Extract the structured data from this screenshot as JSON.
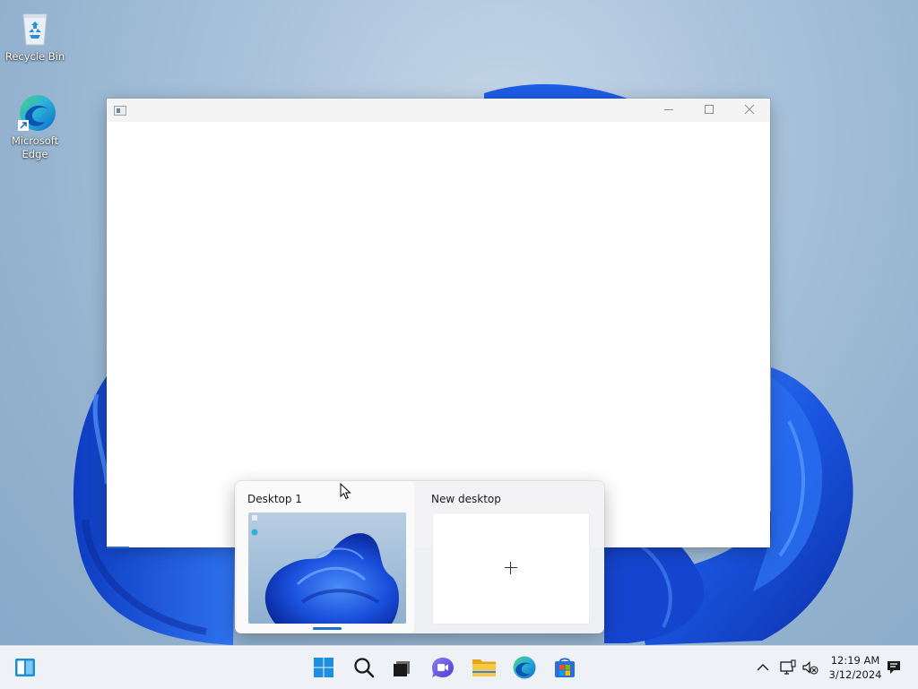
{
  "desktop_icons": [
    {
      "label": "Recycle Bin",
      "icon": "recycle-bin-icon"
    },
    {
      "label_line1": "Microsoft",
      "label_line2": "Edge",
      "icon": "edge-icon"
    }
  ],
  "window": {
    "title": "",
    "controls": {
      "minimize": "minimize-icon",
      "maximize": "maximize-icon",
      "close": "close-icon"
    }
  },
  "task_view": {
    "desktops": [
      {
        "label": "Desktop 1",
        "active": true
      },
      {
        "label": "New desktop",
        "action": "add"
      }
    ]
  },
  "taskbar": {
    "pinned": [
      "widgets-icon",
      "start-icon",
      "search-icon",
      "task-view-icon",
      "chat-icon",
      "file-explorer-icon",
      "edge-icon",
      "store-icon"
    ],
    "tray": [
      "chevron-up-icon",
      "network-icon",
      "volume-muted-icon",
      "notification-icon"
    ],
    "time": "12:19 AM",
    "date": "3/12/2024"
  },
  "colors": {
    "accent": "#1e6fc9",
    "wallpaper_bloom": "#1d5ce6",
    "taskbar_bg": "#eef1f5"
  }
}
